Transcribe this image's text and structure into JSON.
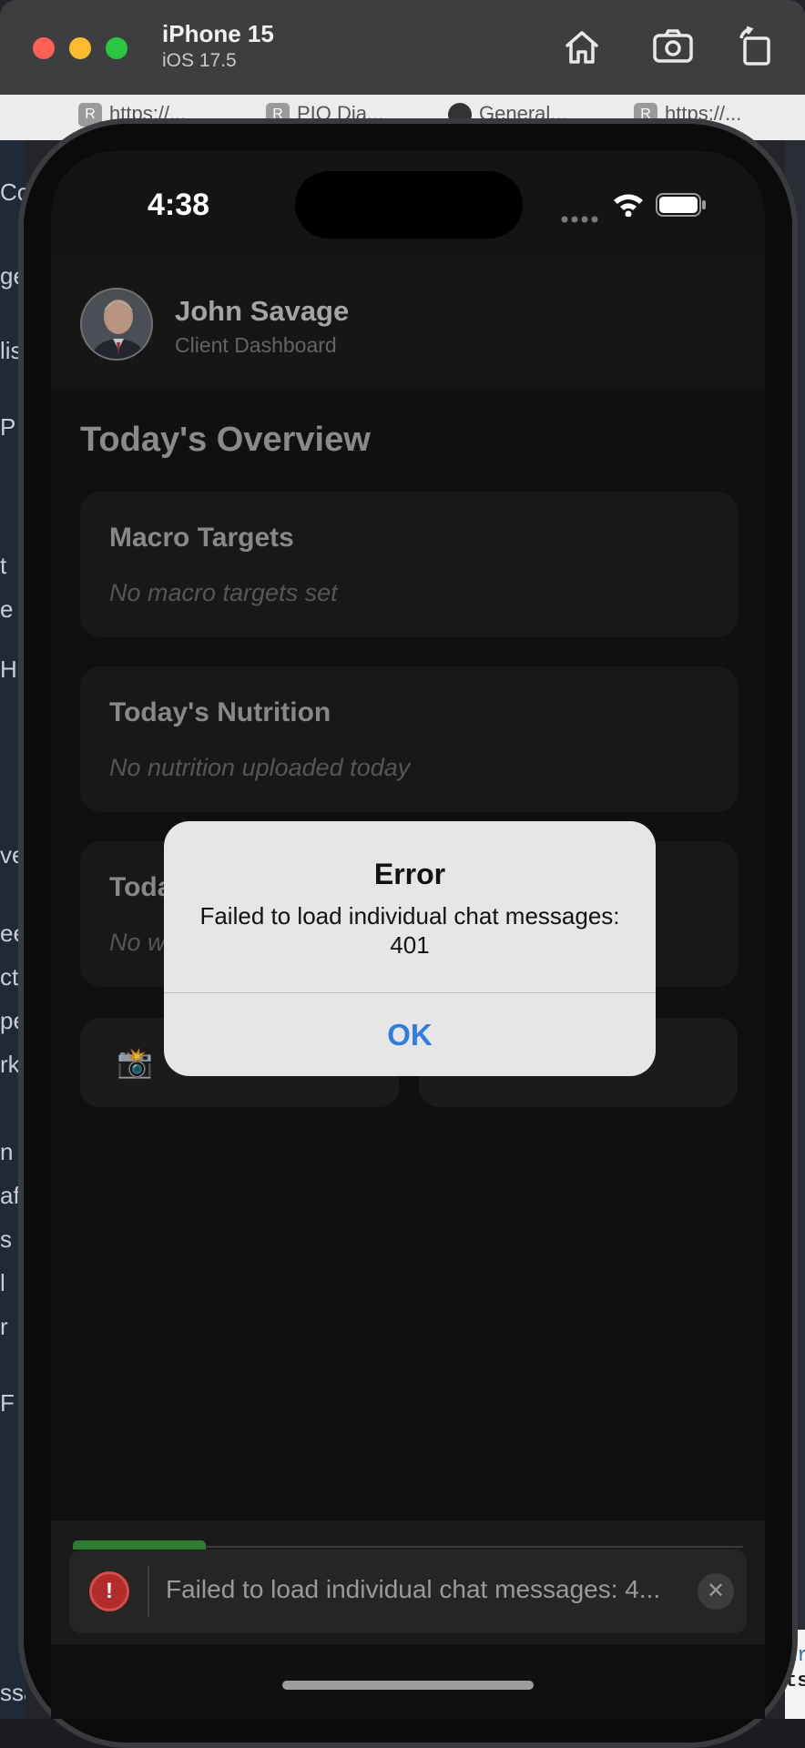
{
  "simulator": {
    "device_name": "iPhone 15",
    "os_version": "iOS 17.5",
    "toolbar_icons": [
      "home-icon",
      "screenshot-icon",
      "rotate-icon"
    ]
  },
  "browser_tabs": [
    {
      "favicon": "R",
      "label": "https://..."
    },
    {
      "favicon": "R",
      "label": "PIO Dia..."
    },
    {
      "favicon": "github",
      "label": "General..."
    },
    {
      "favicon": "R",
      "label": "https://..."
    }
  ],
  "background_fragments": {
    "left": [
      "Co",
      "ge",
      "lis",
      "P",
      "t",
      "e",
      "H",
      "ve",
      "ee",
      "ct",
      "pe",
      "rk",
      "n",
      "af",
      "s",
      "l",
      "r",
      "F",
      "ssag"
    ],
    "right": [
      "ir",
      "ts"
    ]
  },
  "status_bar": {
    "time": "4:38",
    "icons": [
      "signal-dots-icon",
      "wifi-icon",
      "battery-icon"
    ]
  },
  "header": {
    "name": "John Savage",
    "subtitle": "Client Dashboard",
    "avatar": "user-portrait"
  },
  "overview": {
    "title": "Today's Overview",
    "cards": [
      {
        "title": "Macro Targets",
        "subtitle": "No macro targets set"
      },
      {
        "title": "Today's Nutrition",
        "subtitle": "No nutrition uploaded today"
      },
      {
        "title": "Toda",
        "subtitle": "No w"
      }
    ],
    "actions": [
      {
        "icon": "camera-icon",
        "emoji": "📸"
      },
      {
        "icon": "",
        "emoji": ""
      }
    ]
  },
  "alert": {
    "title": "Error",
    "message": "Failed to load individual chat messages: 401",
    "ok_label": "OK"
  },
  "toast": {
    "message": "Failed to load individual chat messages: 4...",
    "close_label": "✕",
    "error_glyph": "!",
    "progress_color": "#2e7d32"
  },
  "colors": {
    "alert_button": "#2f7de1",
    "error_red": "#b32c2c",
    "traffic_close": "#fe5f57",
    "traffic_min": "#febc2e",
    "traffic_max": "#28c840"
  }
}
